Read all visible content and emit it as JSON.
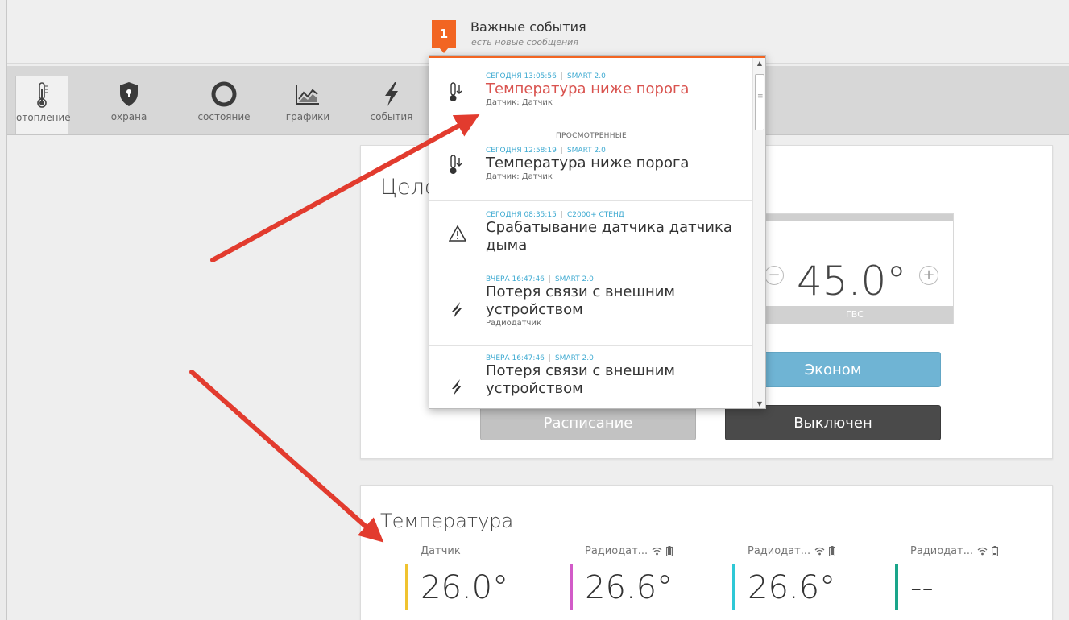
{
  "notification": {
    "count": "1",
    "title": "Важные события",
    "subtitle": "есть новые сообщения"
  },
  "tabs": [
    {
      "label": "отопление",
      "icon": "thermometer-icon",
      "active": true
    },
    {
      "label": "охрана",
      "icon": "shield-lock-icon"
    },
    {
      "label": "состояние",
      "icon": "ring-icon"
    },
    {
      "label": "графики",
      "icon": "chart-icon"
    },
    {
      "label": "события",
      "icon": "lightning-icon"
    }
  ],
  "heating": {
    "title_partial": "Целе",
    "setpoint": {
      "value": "45.0°",
      "label": "ГВС",
      "minus": "−",
      "plus": "+"
    },
    "buttons": {
      "econom": "Эконом",
      "schedule": "Расписание",
      "off": "Выключен"
    }
  },
  "temperature": {
    "title": "Температура",
    "sensors": [
      {
        "name": "Датчик",
        "value": "26.0°",
        "color": "#f0c330"
      },
      {
        "name": "Радиодат...",
        "value": "26.6°",
        "color": "#d25bc8"
      },
      {
        "name": "Радиодат...",
        "value": "26.6°",
        "color": "#2fc8d6"
      },
      {
        "name": "Радиодат...",
        "value": "--",
        "color": "#1aa58a"
      }
    ]
  },
  "events": {
    "new": [
      {
        "time": "СЕГОДНЯ 13:05:56",
        "source": "SMART 2.0",
        "title": "Температура ниже порога",
        "detail": "Датчик: Датчик",
        "icon": "thermometer-down-icon"
      }
    ],
    "seen_label": "ПРОСМОТРЕННЫЕ",
    "seen": [
      {
        "time": "СЕГОДНЯ 12:58:19",
        "source": "SMART 2.0",
        "title": "Температура ниже порога",
        "detail": "Датчик: Датчик",
        "icon": "thermometer-down-icon"
      },
      {
        "time": "СЕГОДНЯ 08:35:15",
        "source": "С2000+ СТЕНД",
        "title": "Срабатывание датчика датчика дыма",
        "detail": "",
        "icon": "warning-icon"
      },
      {
        "time": "ВЧЕРА 16:47:46",
        "source": "SMART 2.0",
        "title": "Потеря связи с внешним устройством",
        "detail": "Радиодатчик",
        "icon": "connection-lost-icon"
      },
      {
        "time": "ВЧЕРА 16:47:46",
        "source": "SMART 2.0",
        "title": "Потеря связи с внешним устройством",
        "detail": "",
        "icon": "connection-lost-icon"
      }
    ]
  },
  "colors": {
    "accent": "#f26522",
    "arrow": "#e23b2e",
    "econom": "#6fb4d4",
    "off": "#4a4a4a"
  }
}
